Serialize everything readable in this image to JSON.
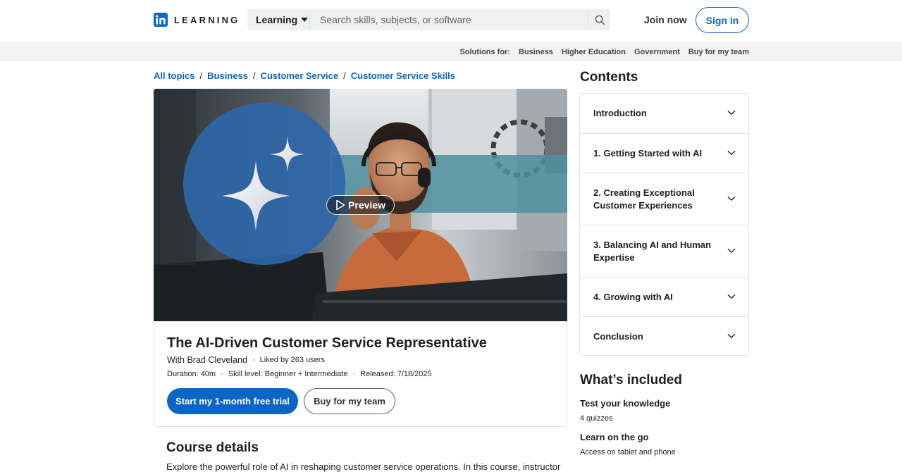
{
  "header": {
    "logo_text": "LEARNING",
    "search_category": "Learning",
    "search_placeholder": "Search skills, subjects, or software",
    "join_label": "Join now",
    "signin_label": "Sign in"
  },
  "solutions": {
    "label": "Solutions for:",
    "links": [
      "Business",
      "Higher Education",
      "Government",
      "Buy for my team"
    ]
  },
  "breadcrumb": [
    "All topics",
    "Business",
    "Customer Service",
    "Customer Service Skills"
  ],
  "hero": {
    "preview_label": "Preview"
  },
  "course": {
    "title": "The AI-Driven Customer Service Representative",
    "instructor": "With Brad Cleveland",
    "liked": "Liked by 263 users",
    "duration": "Duration: 40m",
    "skill": "Skill level: Beginner + Intermediate",
    "released": "Released: 7/18/2025",
    "trial_label": "Start my 1-month free trial",
    "team_label": "Buy for my team"
  },
  "details": {
    "title": "Course details",
    "description": "Explore the powerful role of AI in reshaping customer service operations. In this course, instructor"
  },
  "contents": {
    "title": "Contents",
    "items": [
      "Introduction",
      "1. Getting Started with AI",
      "2. Creating Exceptional Customer Experiences",
      "3. Balancing AI and Human Expertise",
      "4. Growing with AI",
      "Conclusion"
    ]
  },
  "included": {
    "title": "What’s included",
    "items": [
      {
        "head": "Test your knowledge",
        "sub": "4 quizzes"
      },
      {
        "head": "Learn on the go",
        "sub": "Access on tablet and phone"
      }
    ]
  },
  "colors": {
    "brand": "#0a66c2",
    "hero_circle": "#2e66a8",
    "hero_band": "#4f8fa0"
  },
  "icons": [
    "linkedin-logo-icon",
    "caret-down-icon",
    "search-icon",
    "play-icon",
    "sparkle-icon",
    "chevron-down-icon"
  ]
}
